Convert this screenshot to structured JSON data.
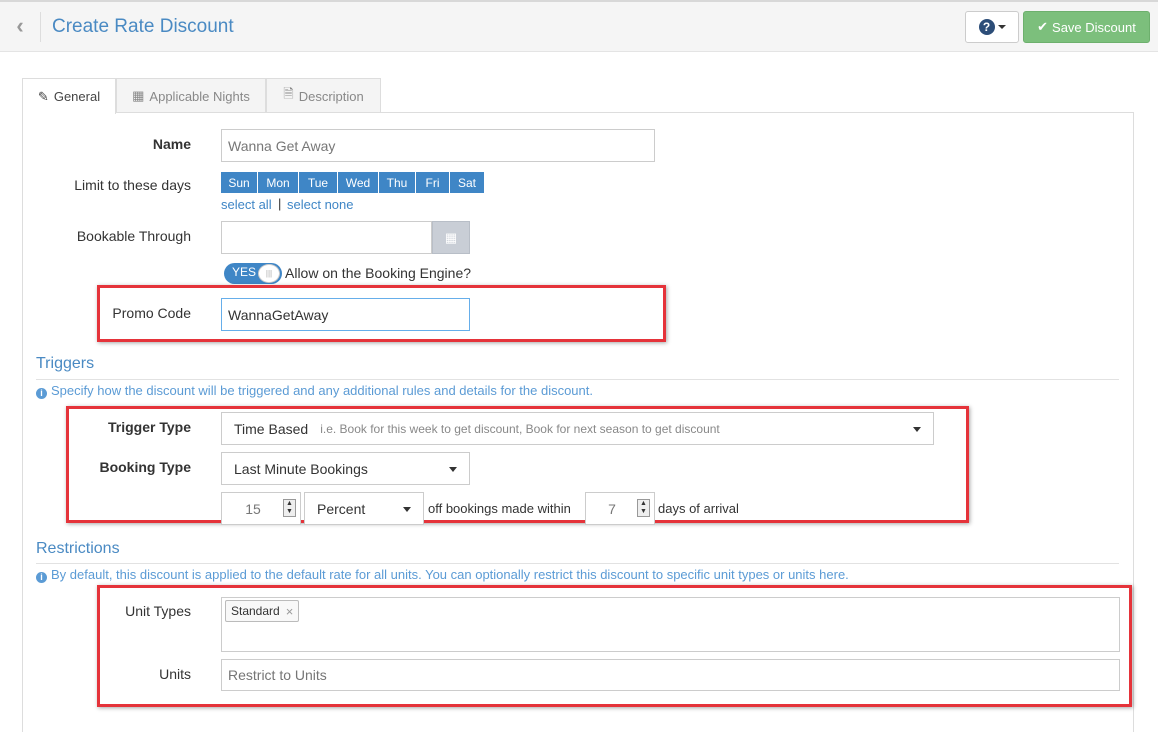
{
  "header": {
    "title": "Create Rate Discount",
    "help_label": "?",
    "save_label": "Save Discount"
  },
  "tabs": [
    {
      "label": "General"
    },
    {
      "label": "Applicable Nights"
    },
    {
      "label": "Description"
    }
  ],
  "general": {
    "name_label": "Name",
    "name_value": "Wanna Get Away",
    "days_label": "Limit to these days",
    "days": [
      "Sun",
      "Mon",
      "Tue",
      "Wed",
      "Thu",
      "Fri",
      "Sat"
    ],
    "select_all": "select all",
    "select_sep": "|",
    "select_none": "select none",
    "bookable_label": "Bookable Through",
    "bookable_value": "",
    "toggle_label": "YES",
    "toggle_text": "Allow on the Booking Engine?",
    "promo_label": "Promo Code",
    "promo_value": "WannaGetAway"
  },
  "triggers": {
    "title": "Triggers",
    "info": "Specify how the discount will be triggered and any additional rules and details for the discount.",
    "trigger_type_label": "Trigger Type",
    "trigger_type_value": "Time Based",
    "trigger_type_hint": "i.e. Book for this week to get discount, Book for next season to get discount",
    "booking_type_label": "Booking Type",
    "booking_type_value": "Last Minute Bookings",
    "amount_value": "15",
    "amount_unit": "Percent",
    "off_text": "off bookings made within",
    "days_value": "7",
    "days_text": "days of arrival"
  },
  "restrictions": {
    "title": "Restrictions",
    "info": "By default, this discount is applied to the default rate for all units. You can optionally restrict this discount to specific unit types or units here.",
    "unit_types_label": "Unit Types",
    "unit_type_tag": "Standard",
    "units_label": "Units",
    "units_placeholder": "Restrict to Units"
  },
  "colors": {
    "accent": "#3f86c6",
    "save_button": "#7cbf7c",
    "highlight_box": "#e5333a"
  }
}
